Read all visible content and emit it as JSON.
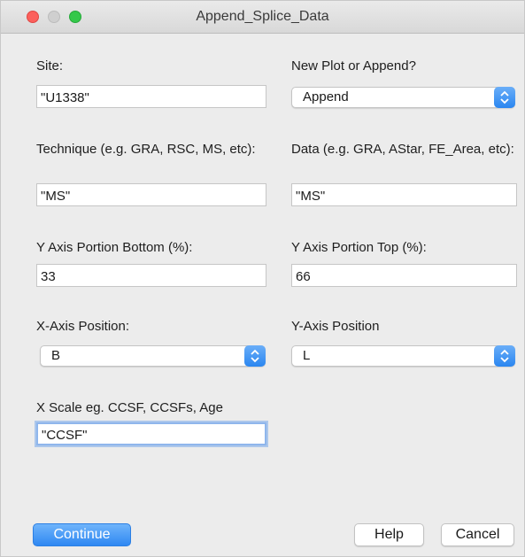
{
  "window": {
    "title": "Append_Splice_Data"
  },
  "fields": {
    "site": {
      "label": "Site:",
      "value": "\"U1338\""
    },
    "new_plot_or_append": {
      "label": "New Plot or Append?",
      "value": "Append"
    },
    "technique": {
      "label": "Technique (e.g. GRA, RSC, MS, etc):",
      "value": "\"MS\""
    },
    "data": {
      "label": "Data (e.g. GRA, AStar, FE_Area, etc):",
      "value": "\"MS\""
    },
    "y_axis_portion_bottom": {
      "label": "Y Axis Portion Bottom (%):",
      "value": "33"
    },
    "y_axis_portion_top": {
      "label": "Y Axis Portion Top (%):",
      "value": "66"
    },
    "x_axis_position": {
      "label": "X-Axis Position:",
      "value": "B"
    },
    "y_axis_position": {
      "label": "Y-Axis Position",
      "value": "L"
    },
    "x_scale": {
      "label": "X Scale eg. CCSF, CCSFs, Age",
      "value": "\"CCSF\""
    }
  },
  "buttons": {
    "continue": "Continue",
    "help": "Help",
    "cancel": "Cancel"
  },
  "colors": {
    "accent": "#2f88f2",
    "close": "#fc605c",
    "zoom": "#34c84a"
  },
  "icons": {
    "popup_arrows": "up-down-chevron-icon"
  }
}
